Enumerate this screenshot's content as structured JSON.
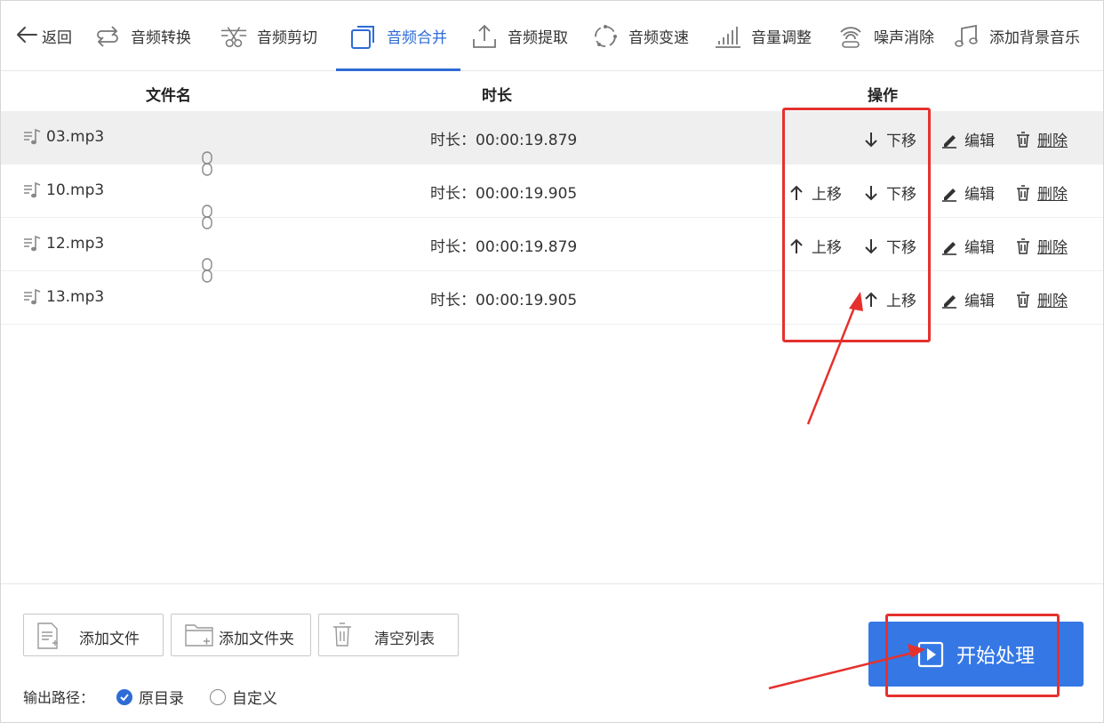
{
  "nav": {
    "back_label": "返回",
    "items": [
      {
        "label": "音频转换",
        "icon": "swap-arrows-icon"
      },
      {
        "label": "音频剪切",
        "icon": "scissors-icon"
      },
      {
        "label": "音频合并",
        "icon": "merge-squares-icon",
        "active": true
      },
      {
        "label": "音频提取",
        "icon": "upload-tray-icon"
      },
      {
        "label": "音频变速",
        "icon": "speed-circle-icon"
      },
      {
        "label": "音量调整",
        "icon": "volume-bars-icon"
      },
      {
        "label": "噪声消除",
        "icon": "noise-wave-icon"
      },
      {
        "label": "添加背景音乐",
        "icon": "music-note-icon"
      }
    ]
  },
  "table": {
    "headers": {
      "filename": "文件名",
      "duration": "时长",
      "actions": "操作"
    },
    "rows": [
      {
        "name": "03.mp3",
        "duration": "时长：00:00:19.879"
      },
      {
        "name": "10.mp3",
        "duration": "时长：00:00:19.905"
      },
      {
        "name": "12.mp3",
        "duration": "时长：00:00:19.879"
      },
      {
        "name": "13.mp3",
        "duration": "时长：00:00:19.905"
      }
    ],
    "actions": {
      "move_up": "上移",
      "move_down": "下移",
      "edit": "编辑",
      "delete": "删除"
    }
  },
  "footer": {
    "add_file": "添加文件",
    "add_folder": "添加文件夹",
    "clear_list": "清空列表",
    "output_label": "输出路径：",
    "option_original": "原目录",
    "option_custom": "自定义",
    "start": "开始处理"
  },
  "colors": {
    "accent": "#3578e5",
    "annotation": "#e5312e"
  }
}
